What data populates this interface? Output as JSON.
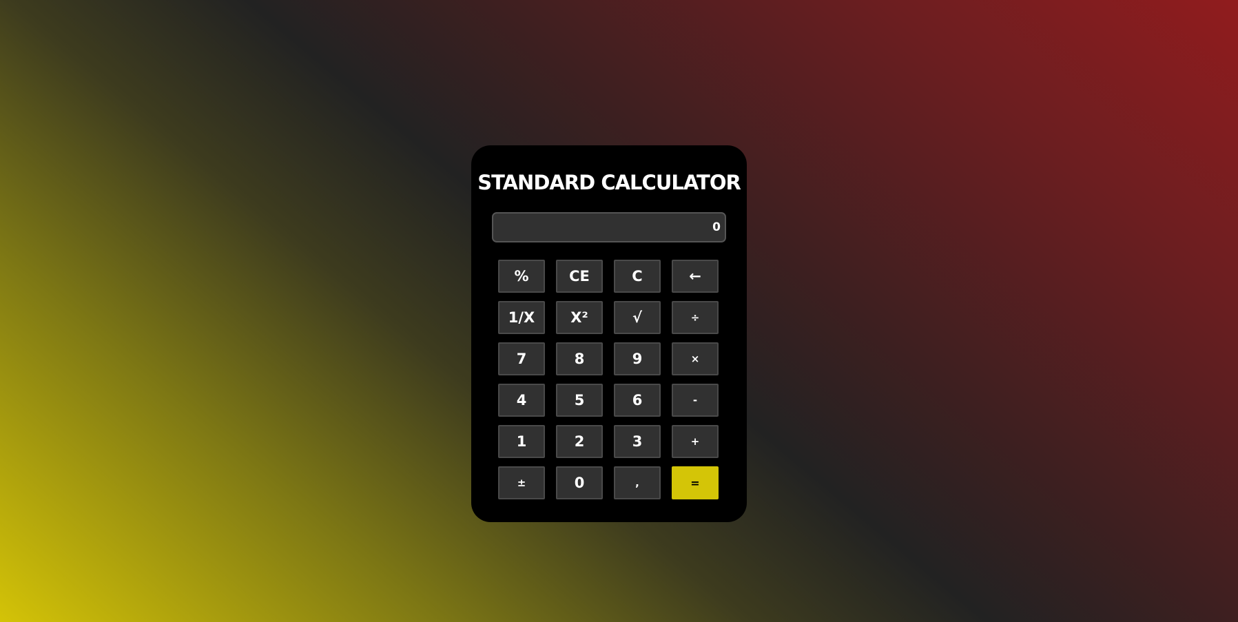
{
  "calculator": {
    "title": "STANDARD CALCULATOR",
    "display_value": "0",
    "rows": [
      [
        {
          "label": "%",
          "name": "percent-button"
        },
        {
          "label": "CE",
          "name": "clear-entry-button"
        },
        {
          "label": "C",
          "name": "clear-button"
        },
        {
          "label": "←",
          "name": "backspace-button"
        }
      ],
      [
        {
          "label": "1/X",
          "name": "reciprocal-button"
        },
        {
          "label": "X²",
          "name": "square-button"
        },
        {
          "label": "√",
          "name": "square-root-button"
        },
        {
          "label": "÷",
          "name": "divide-button"
        }
      ],
      [
        {
          "label": "7",
          "name": "digit-7-button"
        },
        {
          "label": "8",
          "name": "digit-8-button"
        },
        {
          "label": "9",
          "name": "digit-9-button"
        },
        {
          "label": "×",
          "name": "multiply-button"
        }
      ],
      [
        {
          "label": "4",
          "name": "digit-4-button"
        },
        {
          "label": "5",
          "name": "digit-5-button"
        },
        {
          "label": "6",
          "name": "digit-6-button"
        },
        {
          "label": "-",
          "name": "subtract-button"
        }
      ],
      [
        {
          "label": "1",
          "name": "digit-1-button"
        },
        {
          "label": "2",
          "name": "digit-2-button"
        },
        {
          "label": "3",
          "name": "digit-3-button"
        },
        {
          "label": "+",
          "name": "add-button"
        }
      ],
      [
        {
          "label": "±",
          "name": "negate-button"
        },
        {
          "label": "0",
          "name": "digit-0-button"
        },
        {
          "label": ",",
          "name": "decimal-button"
        },
        {
          "label": "=",
          "name": "equals-button"
        }
      ]
    ]
  },
  "colors": {
    "accent": "#d4c507",
    "key_background": "#313131",
    "panel_background": "#000000"
  }
}
